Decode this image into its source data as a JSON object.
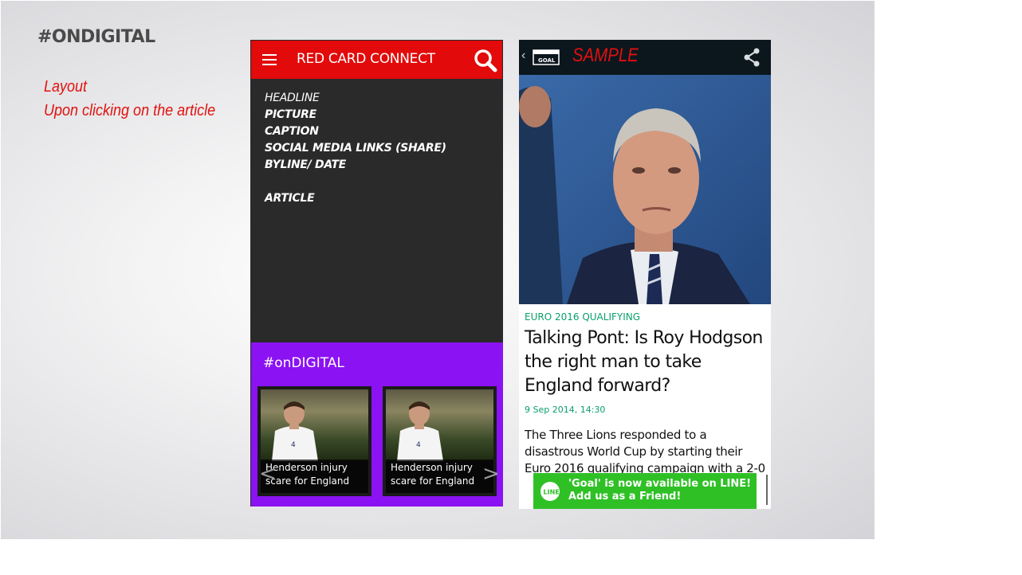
{
  "slide": {
    "title": "#ONDIGITAL",
    "note_line1": "Layout",
    "note_line2": "Upon clicking on the article"
  },
  "mockup": {
    "app_title": "RED CARD CONNECT",
    "menu_icon": "hamburger-menu-icon",
    "search_icon": "search-icon",
    "outline": {
      "headline": "HEADLINE",
      "picture": "PICTURE",
      "caption": "CAPTION",
      "social": "SOCIAL MEDIA LINKS (SHARE)",
      "byline": "BYLINE/ DATE",
      "article": "ARTICLE"
    },
    "section_title": "#onDIGITAL",
    "cards": [
      {
        "caption_line1": "Henderson injury",
        "caption_line2": "scare for England"
      },
      {
        "caption_line1": "Henderson injury",
        "caption_line2": "scare for England"
      }
    ],
    "prev_arrow": "<",
    "next_arrow": ">",
    "colors": {
      "header_red": "#e20a0a",
      "panel_dark": "#2a2a2a",
      "section_purple": "#8b12f2"
    }
  },
  "article": {
    "back_icon": "‹",
    "logo_text": "GOAL",
    "sample_label": "SAMPLE",
    "kicker": "EURO 2016 QUALIFYING",
    "headline": "Talking Pont: Is Roy Hodgson the right man to take England forward?",
    "date": "9 Sep 2014, 14:30",
    "body": "The Three Lions responded to a disastrous World Cup by starting their Euro 2016 qualifying campaign with a 2-0",
    "banner_logo": "LINE",
    "banner_line1": "'Goal' is now available on LINE!",
    "banner_line2": "Add us as a Friend!",
    "colors": {
      "kicker_green": "#0aa06a",
      "banner_green": "#2fc026",
      "topbar": "#0c171d"
    }
  }
}
